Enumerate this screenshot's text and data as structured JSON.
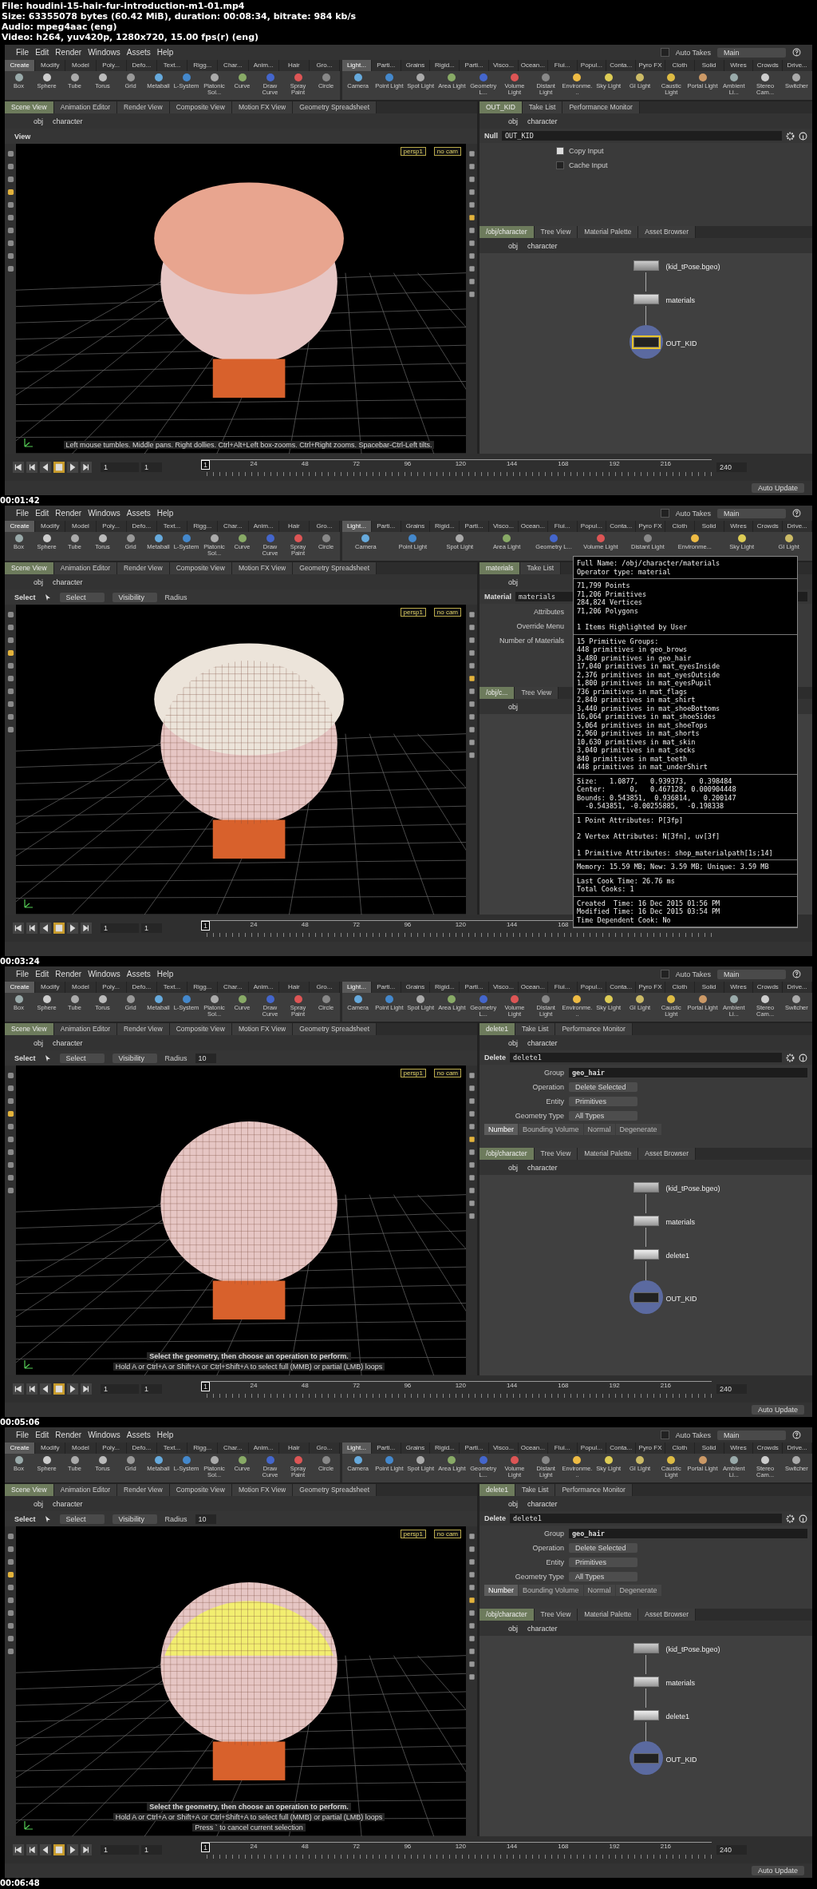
{
  "file_info": [
    "File: houdini-15-hair-fur-introduction-m1-01.mp4",
    "Size: 63355078 bytes (60.42 MiB), duration: 00:08:34, bitrate: 984 kb/s",
    "Audio: mpeg4aac (eng)",
    "Video: h264, yuv420p, 1280x720, 15.00 fps(r) (eng)"
  ],
  "frames": [
    {
      "timestamp": "00:01:42",
      "menu": [
        "File",
        "Edit",
        "Render",
        "Windows",
        "Assets",
        "Help"
      ],
      "auto_takes": {
        "label": "Auto Takes",
        "checked": false
      },
      "desktop": "Main",
      "shelf_tabs_left": [
        {
          "label": "Create",
          "selected": true
        },
        {
          "label": "Modify",
          "selected": false
        },
        {
          "label": "Model",
          "selected": false
        },
        {
          "label": "Poly...",
          "selected": false
        },
        {
          "label": "Defo...",
          "selected": false
        },
        {
          "label": "Text...",
          "selected": false
        },
        {
          "label": "Rigg...",
          "selected": false
        },
        {
          "label": "Char...",
          "selected": false
        },
        {
          "label": "Anim...",
          "selected": false
        },
        {
          "label": "Hair",
          "selected": false
        },
        {
          "label": "Gro...",
          "selected": false
        }
      ],
      "shelf_tabs_right": [
        {
          "label": "Light...",
          "selected": true
        },
        {
          "label": "Parti...",
          "selected": false
        },
        {
          "label": "Grains",
          "selected": false
        },
        {
          "label": "Rigid...",
          "selected": false
        },
        {
          "label": "Parti...",
          "selected": false
        },
        {
          "label": "Visco...",
          "selected": false
        },
        {
          "label": "Ocean...",
          "selected": false
        },
        {
          "label": "Flui...",
          "selected": false
        },
        {
          "label": "Popul...",
          "selected": false
        },
        {
          "label": "Conta...",
          "selected": false
        },
        {
          "label": "Pyro FX",
          "selected": false
        },
        {
          "label": "Cloth",
          "selected": false
        },
        {
          "label": "Solid",
          "selected": false
        },
        {
          "label": "Wires",
          "selected": false
        },
        {
          "label": "Crowds",
          "selected": false
        },
        {
          "label": "Drive...",
          "selected": false
        }
      ],
      "tools_left": [
        "Box",
        "Sphere",
        "Tube",
        "Torus",
        "Grid",
        "Metaball",
        "L-System",
        "Platonic Sol...",
        "Curve",
        "Draw Curve",
        "Spray Paint",
        "Circle"
      ],
      "tools_right": [
        "Camera",
        "Point Light",
        "Spot Light",
        "Area Light",
        "Geometry L...",
        "Volume Light",
        "Distant Light",
        "Environme...",
        "Sky Light",
        "GI Light",
        "Caustic Light",
        "Portal Light",
        "Ambient Li...",
        "Stereo Cam...",
        "Switcher"
      ],
      "view_tabs": [
        {
          "label": "Scene View",
          "selected": true
        },
        {
          "label": "Animation Editor",
          "selected": false
        },
        {
          "label": "Render View",
          "selected": false
        },
        {
          "label": "Composite View",
          "selected": false
        },
        {
          "label": "Motion FX View",
          "selected": false
        },
        {
          "label": "Geometry Spreadsheet",
          "selected": false
        }
      ],
      "path": [
        "obj",
        "character"
      ],
      "viewport": {
        "toolbar": {
          "kind": "view",
          "title": "View"
        },
        "camera": "persp1",
        "cam": "no cam",
        "hair_visible": true,
        "wireframe": false,
        "geometry_selected": false,
        "hints": [
          {
            "kind": "plain",
            "text": "Left mouse tumbles. Middle pans. Right dollies. Ctrl+Alt+Left box-zooms. Ctrl+Right zooms. Spacebar-Ctrl-Left tilts."
          }
        ]
      },
      "param_tabs": [
        {
          "label": "OUT_KID",
          "selected": true
        },
        {
          "label": "Take List",
          "selected": false
        },
        {
          "label": "Performance Monitor",
          "selected": false
        }
      ],
      "param_path": [
        "obj",
        "character"
      ],
      "node_header": {
        "type": "Null",
        "name": "OUT_KID"
      },
      "params": [
        {
          "kind": "checkbox",
          "label": "Copy Input",
          "checked": true
        },
        {
          "kind": "checkbox",
          "label": "Cache Input",
          "checked": false
        }
      ],
      "network_tabs": [
        {
          "label": "/obj/character",
          "selected": true
        },
        {
          "label": "Tree View",
          "selected": false
        },
        {
          "label": "Material Palette",
          "selected": false
        },
        {
          "label": "Asset Browser",
          "selected": false
        }
      ],
      "network_path": [
        "obj",
        "character"
      ],
      "nodes": [
        {
          "kind": "file",
          "label": "(kid_tPose.bgeo)",
          "selected": false
        },
        {
          "kind": "material",
          "label": "materials",
          "selected": false
        },
        {
          "kind": "null",
          "label": "OUT_KID",
          "selected": true
        }
      ],
      "timeline": {
        "frame": "1",
        "start": "1",
        "current": "1",
        "ticks": [
          "24",
          "48",
          "72",
          "96",
          "120",
          "144",
          "168",
          "192",
          "216"
        ],
        "end": "240"
      },
      "status": "Auto Update"
    },
    {
      "timestamp": "00:03:24",
      "menu": [
        "File",
        "Edit",
        "Render",
        "Windows",
        "Assets",
        "Help"
      ],
      "auto_takes": {
        "label": "Auto Takes",
        "checked": false
      },
      "desktop": "Main",
      "shelf_tabs_left": [
        {
          "label": "Create",
          "selected": true
        },
        {
          "label": "Modify",
          "selected": false
        },
        {
          "label": "Model",
          "selected": false
        },
        {
          "label": "Poly...",
          "selected": false
        },
        {
          "label": "Defo...",
          "selected": false
        },
        {
          "label": "Text...",
          "selected": false
        },
        {
          "label": "Rigg...",
          "selected": false
        },
        {
          "label": "Char...",
          "selected": false
        },
        {
          "label": "Anim...",
          "selected": false
        },
        {
          "label": "Hair",
          "selected": false
        },
        {
          "label": "Gro...",
          "selected": false
        }
      ],
      "shelf_tabs_right": [
        {
          "label": "Light...",
          "selected": true
        },
        {
          "label": "Parti...",
          "selected": false
        },
        {
          "label": "Grains",
          "selected": false
        },
        {
          "label": "Rigid...",
          "selected": false
        },
        {
          "label": "Parti...",
          "selected": false
        },
        {
          "label": "Visco...",
          "selected": false
        },
        {
          "label": "Ocean...",
          "selected": false
        },
        {
          "label": "Flui...",
          "selected": false
        },
        {
          "label": "Popul...",
          "selected": false
        },
        {
          "label": "Conta...",
          "selected": false
        },
        {
          "label": "Pyro FX",
          "selected": false
        },
        {
          "label": "Cloth",
          "selected": false
        },
        {
          "label": "Solid",
          "selected": false
        },
        {
          "label": "Wires",
          "selected": false
        },
        {
          "label": "Crowds",
          "selected": false
        },
        {
          "label": "Drive...",
          "selected": false
        }
      ],
      "tools_left": [
        "Box",
        "Sphere",
        "Tube",
        "Torus",
        "Grid",
        "Metaball",
        "L-System",
        "Platonic Sol...",
        "Curve",
        "Draw Curve",
        "Spray Paint",
        "Circle"
      ],
      "tools_right": [
        "Camera",
        "Point Light",
        "Spot Light",
        "Area Light",
        "Geometry L...",
        "Volume Light",
        "Distant Light",
        "Environme...",
        "Sky Light",
        "GI Light"
      ],
      "view_tabs": [
        {
          "label": "Scene View",
          "selected": true
        },
        {
          "label": "Animation Editor",
          "selected": false
        },
        {
          "label": "Render View",
          "selected": false
        },
        {
          "label": "Composite View",
          "selected": false
        },
        {
          "label": "Motion FX View",
          "selected": false
        },
        {
          "label": "Geometry Spreadsheet",
          "selected": false
        }
      ],
      "path": [
        "obj",
        "character"
      ],
      "viewport": {
        "toolbar": {
          "kind": "select",
          "title": "Select",
          "mode": "Select",
          "visibility": "Visibility",
          "radius": "Radius"
        },
        "camera": "persp1",
        "cam": "no cam",
        "hair_visible": true,
        "wireframe": true,
        "geometry_selected": false
      },
      "param_tabs": [
        {
          "label": "materials",
          "selected": true
        },
        {
          "label": "Take List",
          "selected": false
        }
      ],
      "param_path": [
        "obj"
      ],
      "node_header": {
        "type": "Material",
        "name": "materials"
      },
      "params": [
        {
          "kind": "label",
          "label": "Attributes"
        },
        {
          "kind": "label",
          "label": "Override Menu"
        },
        {
          "kind": "label",
          "label": "Number of Materials"
        }
      ],
      "network_tabs": [
        {
          "label": "/obj/c...",
          "selected": true
        },
        {
          "label": "Tree View",
          "selected": false
        }
      ],
      "network_path": [
        "obj"
      ],
      "timeline": {
        "frame": "1",
        "start": "1",
        "current": "1",
        "ticks": [
          "24",
          "48",
          "72",
          "96",
          "120",
          "144",
          "168"
        ]
      },
      "info_popup": [
        [
          [
            "Full Name: /obj/character/materials",
            "Operator type: material"
          ]
        ],
        [
          [
            "71,799 Points",
            "71,206 Primitives",
            "284,824 Vertices",
            "71,206 Polygons"
          ],
          [
            "1 Items Highlighted by User"
          ]
        ],
        [
          [
            "15 Primitive Groups:",
            "448 primitives in geo_brows",
            "3,480 primitives in geo_hair",
            "17,040 primitives in mat_eyesInside",
            "2,376 primitives in mat_eyesOutside",
            "1,800 primitives in mat_eyesPupil",
            "736 primitives in mat_flags",
            "2,840 primitives in mat_shirt",
            "3,440 primitives in mat_shoeBottoms",
            "16,064 primitives in mat_shoeSides",
            "5,064 primitives in mat_shoeTops",
            "2,960 primitives in mat_shorts",
            "10,630 primitives in mat_skin",
            "3,040 primitives in mat_socks",
            "840 primitives in mat_teeth",
            "448 primitives in mat_underShirt"
          ]
        ],
        [
          [
            "Size:   1.0877,   0.939373,   0.398484",
            "Center:      0,   0.467128, 0.000904448",
            "Bounds: 0.543851,  0.936814,   0.200147",
            "  -0.543851, -0.00255885,  -0.198338"
          ]
        ],
        [
          [
            "1 Point Attributes: P[3fp]"
          ],
          [
            "2 Vertex Attributes: N[3fn], uv[3f]"
          ],
          [
            "1 Primitive Attributes: shop_materialpath[1s;14]"
          ]
        ],
        [
          [
            "Memory: 15.59 MB; New: 3.59 MB; Unique: 3.59 MB"
          ]
        ],
        [
          [
            "Last Cook Time: 26.76 ms",
            "Total Cooks: 1"
          ]
        ],
        [
          [
            "Created  Time: 16 Dec 2015 01:56 PM",
            "Modified Time: 16 Dec 2015 03:54 PM",
            "Time Dependent Cook: No"
          ]
        ]
      ]
    },
    {
      "timestamp": "00:05:06",
      "menu": [
        "File",
        "Edit",
        "Render",
        "Windows",
        "Assets",
        "Help"
      ],
      "auto_takes": {
        "label": "Auto Takes",
        "checked": false
      },
      "desktop": "Main",
      "shelf_tabs_left": [
        {
          "label": "Create",
          "selected": true
        },
        {
          "label": "Modify",
          "selected": false
        },
        {
          "label": "Model",
          "selected": false
        },
        {
          "label": "Poly...",
          "selected": false
        },
        {
          "label": "Defo...",
          "selected": false
        },
        {
          "label": "Text...",
          "selected": false
        },
        {
          "label": "Rigg...",
          "selected": false
        },
        {
          "label": "Char...",
          "selected": false
        },
        {
          "label": "Anim...",
          "selected": false
        },
        {
          "label": "Hair",
          "selected": false
        },
        {
          "label": "Gro...",
          "selected": false
        }
      ],
      "shelf_tabs_right": [
        {
          "label": "Light...",
          "selected": true
        },
        {
          "label": "Parti...",
          "selected": false
        },
        {
          "label": "Grains",
          "selected": false
        },
        {
          "label": "Rigid...",
          "selected": false
        },
        {
          "label": "Parti...",
          "selected": false
        },
        {
          "label": "Visco...",
          "selected": false
        },
        {
          "label": "Ocean...",
          "selected": false
        },
        {
          "label": "Flui...",
          "selected": false
        },
        {
          "label": "Popul...",
          "selected": false
        },
        {
          "label": "Conta...",
          "selected": false
        },
        {
          "label": "Pyro FX",
          "selected": false
        },
        {
          "label": "Cloth",
          "selected": false
        },
        {
          "label": "Solid",
          "selected": false
        },
        {
          "label": "Wires",
          "selected": false
        },
        {
          "label": "Crowds",
          "selected": false
        },
        {
          "label": "Drive...",
          "selected": false
        }
      ],
      "tools_left": [
        "Box",
        "Sphere",
        "Tube",
        "Torus",
        "Grid",
        "Metaball",
        "L-System",
        "Platonic Sol...",
        "Curve",
        "Draw Curve",
        "Spray Paint",
        "Circle"
      ],
      "tools_right": [
        "Camera",
        "Point Light",
        "Spot Light",
        "Area Light",
        "Geometry L...",
        "Volume Light",
        "Distant Light",
        "Environme...",
        "Sky Light",
        "GI Light",
        "Caustic Light",
        "Portal Light",
        "Ambient Li...",
        "Stereo Cam...",
        "Switcher"
      ],
      "view_tabs": [
        {
          "label": "Scene View",
          "selected": true
        },
        {
          "label": "Animation Editor",
          "selected": false
        },
        {
          "label": "Render View",
          "selected": false
        },
        {
          "label": "Composite View",
          "selected": false
        },
        {
          "label": "Motion FX View",
          "selected": false
        },
        {
          "label": "Geometry Spreadsheet",
          "selected": false
        }
      ],
      "path": [
        "obj",
        "character"
      ],
      "viewport": {
        "toolbar": {
          "kind": "select",
          "title": "Select",
          "mode": "Select",
          "visibility": "Visibility",
          "radius": "Radius",
          "radius_value": "10"
        },
        "camera": "persp1",
        "cam": "no cam",
        "hair_visible": false,
        "wireframe": true,
        "geometry_selected": false,
        "hints": [
          {
            "kind": "title",
            "text": "Select the geometry, then choose an operation to perform."
          },
          {
            "kind": "plain",
            "text": "Hold A or Ctrl+A or Shift+A or Ctrl+Shift+A to select full (MMB) or partial (LMB) loops"
          }
        ]
      },
      "param_tabs": [
        {
          "label": "delete1",
          "selected": true
        },
        {
          "label": "Take List",
          "selected": false
        },
        {
          "label": "Performance Monitor",
          "selected": false
        }
      ],
      "param_path": [
        "obj",
        "character"
      ],
      "node_header": {
        "type": "Delete",
        "name": "delete1"
      },
      "params": [
        {
          "kind": "field",
          "label": "Group",
          "value": "geo_hair"
        },
        {
          "kind": "menu",
          "label": "Operation",
          "value": "Delete Selected"
        },
        {
          "kind": "menu",
          "label": "Entity",
          "value": "Primitives"
        },
        {
          "kind": "menu",
          "label": "Geometry Type",
          "value": "All Types"
        },
        {
          "kind": "tabs",
          "items": [
            {
              "label": "Number",
              "selected": true
            },
            {
              "label": "Bounding Volume",
              "selected": false
            },
            {
              "label": "Normal",
              "selected": false
            },
            {
              "label": "Degenerate",
              "selected": false
            }
          ]
        }
      ],
      "network_tabs": [
        {
          "label": "/obj/character",
          "selected": true
        },
        {
          "label": "Tree View",
          "selected": false
        },
        {
          "label": "Material Palette",
          "selected": false
        },
        {
          "label": "Asset Browser",
          "selected": false
        }
      ],
      "network_path": [
        "obj",
        "character"
      ],
      "nodes": [
        {
          "kind": "file",
          "label": "(kid_tPose.bgeo)",
          "selected": false
        },
        {
          "kind": "material",
          "label": "materials",
          "selected": false
        },
        {
          "kind": "delete",
          "label": "delete1",
          "selected": false
        },
        {
          "kind": "null",
          "label": "OUT_KID",
          "selected": false
        }
      ],
      "timeline": {
        "frame": "1",
        "start": "1",
        "current": "1",
        "ticks": [
          "24",
          "48",
          "72",
          "96",
          "120",
          "144",
          "168",
          "192",
          "216"
        ],
        "end": "240"
      },
      "status": "Auto Update"
    },
    {
      "timestamp": "00:06:48",
      "menu": [
        "File",
        "Edit",
        "Render",
        "Windows",
        "Assets",
        "Help"
      ],
      "auto_takes": {
        "label": "Auto Takes",
        "checked": false
      },
      "desktop": "Main",
      "shelf_tabs_left": [
        {
          "label": "Create",
          "selected": true
        },
        {
          "label": "Modify",
          "selected": false
        },
        {
          "label": "Model",
          "selected": false
        },
        {
          "label": "Poly...",
          "selected": false
        },
        {
          "label": "Defo...",
          "selected": false
        },
        {
          "label": "Text...",
          "selected": false
        },
        {
          "label": "Rigg...",
          "selected": false
        },
        {
          "label": "Char...",
          "selected": false
        },
        {
          "label": "Anim...",
          "selected": false
        },
        {
          "label": "Hair",
          "selected": false
        },
        {
          "label": "Gro...",
          "selected": false
        }
      ],
      "shelf_tabs_right": [
        {
          "label": "Light...",
          "selected": true
        },
        {
          "label": "Parti...",
          "selected": false
        },
        {
          "label": "Grains",
          "selected": false
        },
        {
          "label": "Rigid...",
          "selected": false
        },
        {
          "label": "Parti...",
          "selected": false
        },
        {
          "label": "Visco...",
          "selected": false
        },
        {
          "label": "Ocean...",
          "selected": false
        },
        {
          "label": "Flui...",
          "selected": false
        },
        {
          "label": "Popul...",
          "selected": false
        },
        {
          "label": "Conta...",
          "selected": false
        },
        {
          "label": "Pyro FX",
          "selected": false
        },
        {
          "label": "Cloth",
          "selected": false
        },
        {
          "label": "Solid",
          "selected": false
        },
        {
          "label": "Wires",
          "selected": false
        },
        {
          "label": "Crowds",
          "selected": false
        },
        {
          "label": "Drive...",
          "selected": false
        }
      ],
      "tools_left": [
        "Box",
        "Sphere",
        "Tube",
        "Torus",
        "Grid",
        "Metaball",
        "L-System",
        "Platonic Sol...",
        "Curve",
        "Draw Curve",
        "Spray Paint",
        "Circle"
      ],
      "tools_right": [
        "Camera",
        "Point Light",
        "Spot Light",
        "Area Light",
        "Geometry L...",
        "Volume Light",
        "Distant Light",
        "Environme...",
        "Sky Light",
        "GI Light",
        "Caustic Light",
        "Portal Light",
        "Ambient Li...",
        "Stereo Cam...",
        "Switcher"
      ],
      "view_tabs": [
        {
          "label": "Scene View",
          "selected": true
        },
        {
          "label": "Animation Editor",
          "selected": false
        },
        {
          "label": "Render View",
          "selected": false
        },
        {
          "label": "Composite View",
          "selected": false
        },
        {
          "label": "Motion FX View",
          "selected": false
        },
        {
          "label": "Geometry Spreadsheet",
          "selected": false
        }
      ],
      "path": [
        "obj",
        "character"
      ],
      "viewport": {
        "toolbar": {
          "kind": "select",
          "title": "Select",
          "mode": "Select",
          "visibility": "Visibility",
          "radius": "Radius",
          "radius_value": "10"
        },
        "camera": "persp1",
        "cam": "no cam",
        "hair_visible": false,
        "wireframe": true,
        "geometry_selected": true,
        "hints": [
          {
            "kind": "title",
            "text": "Select the geometry, then choose an operation to perform."
          },
          {
            "kind": "plain",
            "text": "Hold A or Ctrl+A or Shift+A or Ctrl+Shift+A to select full (MMB) or partial (LMB) loops"
          },
          {
            "kind": "plain",
            "text": "Press ` to cancel current selection"
          }
        ]
      },
      "param_tabs": [
        {
          "label": "delete1",
          "selected": true
        },
        {
          "label": "Take List",
          "selected": false
        },
        {
          "label": "Performance Monitor",
          "selected": false
        }
      ],
      "param_path": [
        "obj",
        "character"
      ],
      "node_header": {
        "type": "Delete",
        "name": "delete1"
      },
      "params": [
        {
          "kind": "field",
          "label": "Group",
          "value": "geo_hair"
        },
        {
          "kind": "menu",
          "label": "Operation",
          "value": "Delete Selected"
        },
        {
          "kind": "menu",
          "label": "Entity",
          "value": "Primitives"
        },
        {
          "kind": "menu",
          "label": "Geometry Type",
          "value": "All Types"
        },
        {
          "kind": "tabs",
          "items": [
            {
              "label": "Number",
              "selected": true
            },
            {
              "label": "Bounding Volume",
              "selected": false
            },
            {
              "label": "Normal",
              "selected": false
            },
            {
              "label": "Degenerate",
              "selected": false
            }
          ]
        }
      ],
      "network_tabs": [
        {
          "label": "/obj/character",
          "selected": true
        },
        {
          "label": "Tree View",
          "selected": false
        },
        {
          "label": "Material Palette",
          "selected": false
        },
        {
          "label": "Asset Browser",
          "selected": false
        }
      ],
      "network_path": [
        "obj",
        "character"
      ],
      "nodes": [
        {
          "kind": "file",
          "label": "(kid_tPose.bgeo)",
          "selected": false
        },
        {
          "kind": "material",
          "label": "materials",
          "selected": false
        },
        {
          "kind": "delete",
          "label": "delete1",
          "selected": false
        },
        {
          "kind": "null",
          "label": "OUT_KID",
          "selected": false
        }
      ],
      "timeline": {
        "frame": "1",
        "start": "1",
        "current": "1",
        "ticks": [
          "24",
          "48",
          "72",
          "96",
          "120",
          "144",
          "168",
          "192",
          "216"
        ],
        "end": "240"
      },
      "status": "Auto Update"
    }
  ]
}
